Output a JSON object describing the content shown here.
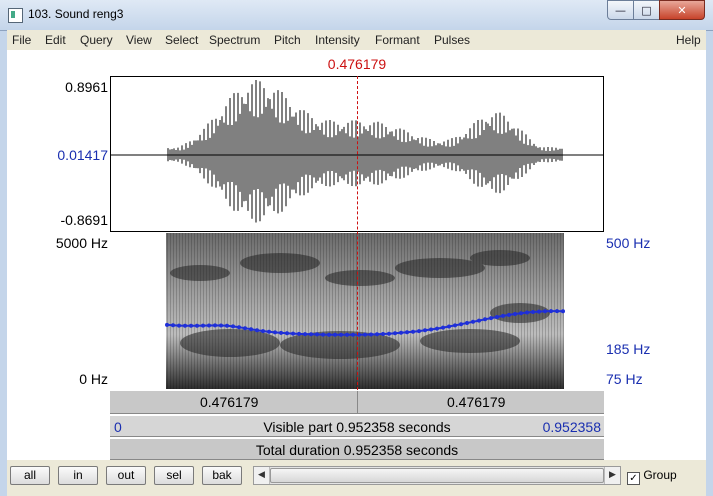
{
  "window": {
    "title": "103. Sound reng3",
    "min_icon": "minimize-icon",
    "max_icon": "maximize-icon",
    "close_icon": "close-icon"
  },
  "menu": {
    "left": [
      "File",
      "Edit",
      "Query",
      "View",
      "Select",
      "Spectrum",
      "Pitch",
      "Intensity",
      "Formant",
      "Pulses"
    ],
    "right": "Help"
  },
  "cursor": {
    "time": "0.476179",
    "position_s": 0.476179
  },
  "waveform": {
    "ymax": "0.8961",
    "ymid": "0.01417",
    "ymin": "-0.8691"
  },
  "spectrogram": {
    "freq_top": "5000 Hz",
    "freq_bottom": "0 Hz"
  },
  "pitch_axis": {
    "top": "500 Hz",
    "mid": "185 Hz",
    "bottom": "75 Hz"
  },
  "time_bar": {
    "left_segment": "0.476179",
    "right_segment": "0.476179"
  },
  "visible_bar": {
    "start": "0",
    "label": "Visible part 0.952358 seconds",
    "end": "0.952358"
  },
  "total_bar": {
    "label": "Total duration 0.952358 seconds"
  },
  "buttons": {
    "all": "all",
    "in": "in",
    "out": "out",
    "sel": "sel",
    "bak": "bak"
  },
  "group": {
    "label": "Group",
    "checked": true
  },
  "colors": {
    "cursor": "#cc1111",
    "axis_blue": "#1a2fb0",
    "pitch": "#1f2fd8"
  }
}
